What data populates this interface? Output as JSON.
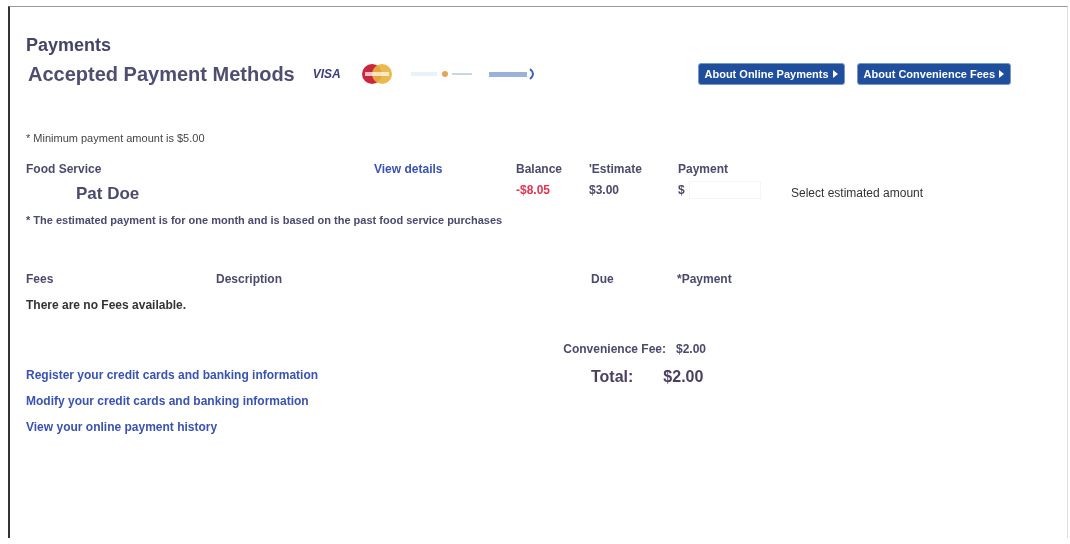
{
  "title": "Payments",
  "methods": {
    "heading": "Accepted Payment Methods",
    "cards": [
      {
        "kind": "visa",
        "text": "VISA"
      },
      {
        "kind": "mastercard"
      },
      {
        "kind": "discover"
      },
      {
        "kind": "amex"
      }
    ]
  },
  "buttons": [
    "About Online Payments",
    "About Convenience Fees"
  ],
  "minimum_note": "* Minimum payment amount is $5.00",
  "food_service": {
    "columns": [
      "Food Service",
      "View details",
      "Balance",
      "'Estimate",
      "Payment"
    ],
    "rows": [
      {
        "name": "Pat Doe",
        "balance": "-$8.05",
        "negative": true,
        "estimate": "$3.00",
        "currency": "$",
        "action": "Select estimated amount"
      }
    ],
    "note": "* The estimated payment is for one month and is based on the past food service purchases"
  },
  "fees": {
    "columns": [
      "Fees",
      "Description",
      "Due",
      "*Payment"
    ],
    "empty": "There are no Fees available."
  },
  "convenience_fee": {
    "label": "Convenience Fee:",
    "value": "$2.00"
  },
  "total": {
    "label": "Total:",
    "value": "$2.00"
  },
  "links": [
    "Register your credit cards and banking information",
    "Modify your credit cards and banking information",
    "View your online payment history"
  ]
}
